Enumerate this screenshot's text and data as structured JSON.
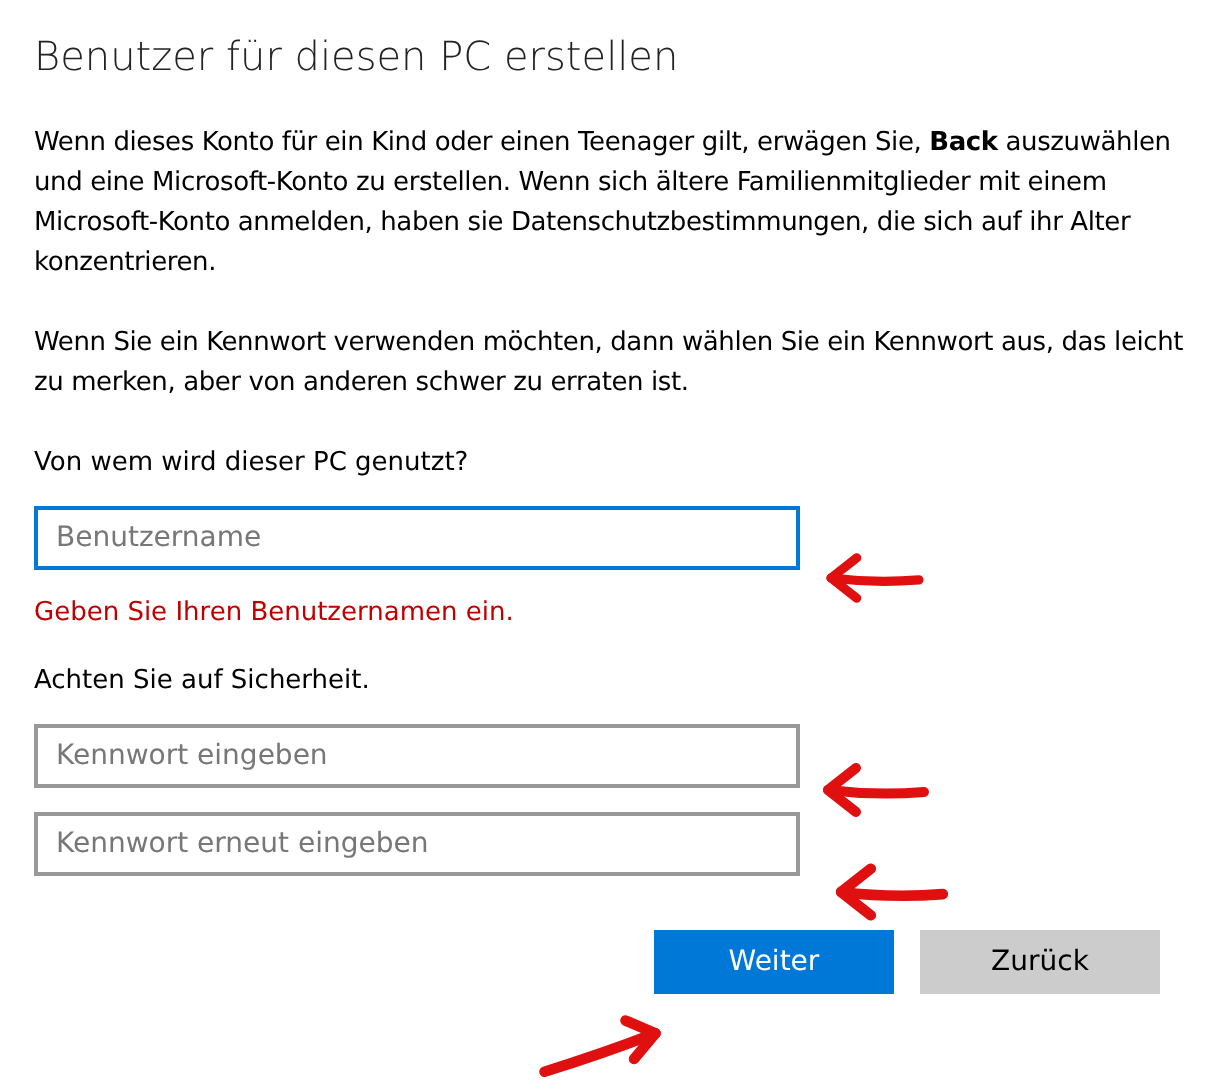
{
  "title": "Benutzer für diesen PC erstellen",
  "intro": "Wenn dieses Konto für ein Kind oder einen Teenager gilt, erwägen Sie, **Back** auszuwählen und eine Microsoft-Konto zu erstellen. Wenn sich ältere Familienmitglieder mit einem Microsoft-Konto anmelden, haben sie Datenschutzbestimmungen, die sich auf ihr Alter konzentrieren.",
  "password_hint": "Wenn Sie ein Kennwort verwenden möchten, dann wählen Sie ein Kennwort aus, das leicht zu merken, aber von anderen schwer zu erraten ist.",
  "user_label": "Von wem wird dieser PC genutzt?",
  "username_field": {
    "placeholder": "Benutzername",
    "focused": true
  },
  "error": "Geben Sie Ihren Benutzernamen ein.",
  "security_label": "Achten Sie auf Sicherheit.",
  "password_fields": [
    {
      "placeholder": "Kennwort eingeben",
      "focused": false
    },
    {
      "placeholder": "Kennwort erneut eingeben",
      "focused": false
    }
  ],
  "buttons": [
    {
      "label": "Weiter",
      "kind": "primary"
    },
    {
      "label": "Zurück",
      "kind": "secondary"
    }
  ]
}
